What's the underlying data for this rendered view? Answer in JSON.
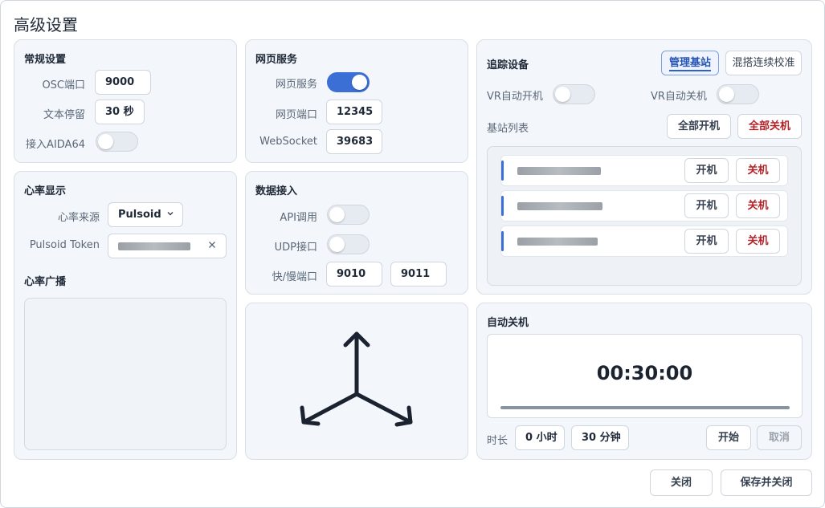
{
  "title": "高级设置",
  "general": {
    "heading": "常规设置",
    "osc_label": "OSC端口",
    "osc_value": "9000",
    "text_label": "文本停留",
    "text_value": "30 秒",
    "aida_label": "接入AIDA64",
    "aida_on": false
  },
  "web": {
    "heading": "网页服务",
    "service_label": "网页服务",
    "service_on": true,
    "port_label": "网页端口",
    "port_value": "12345",
    "ws_label": "WebSocket",
    "ws_value": "39683"
  },
  "heart": {
    "heading": "心率显示",
    "source_label": "心率来源",
    "source_value": "Pulsoid",
    "token_label": "Pulsoid Token",
    "broadcast_label": "心率广播"
  },
  "data": {
    "heading": "数据接入",
    "api_label": "API调用",
    "api_on": false,
    "udp_label": "UDP接口",
    "udp_on": false,
    "fastslow_label": "快/慢端口",
    "fast_value": "9010",
    "slow_value": "9011"
  },
  "tracking": {
    "heading": "追踪设备",
    "tab_manage": "管理基站",
    "tab_mix": "混搭连续校准",
    "vr_on_label": "VR自动开机",
    "vr_on_enabled": false,
    "vr_off_label": "VR自动关机",
    "vr_off_enabled": false,
    "list_label": "基站列表",
    "all_on": "全部开机",
    "all_off": "全部关机",
    "stations": [
      {
        "on_label": "开机",
        "off_label": "关机"
      },
      {
        "on_label": "开机",
        "off_label": "关机"
      },
      {
        "on_label": "开机",
        "off_label": "关机"
      }
    ]
  },
  "auto_off": {
    "heading": "自动关机",
    "time": "00:30:00",
    "duration_label": "时长",
    "hours_value": "0 小时",
    "minutes_value": "30 分钟",
    "start": "开始",
    "cancel": "取消"
  },
  "footer": {
    "close": "关闭",
    "save_close": "保存并关闭"
  },
  "colors": {
    "accent": "#3b6fd6",
    "danger": "#b4232a",
    "panel_bg": "#f3f6fa"
  }
}
